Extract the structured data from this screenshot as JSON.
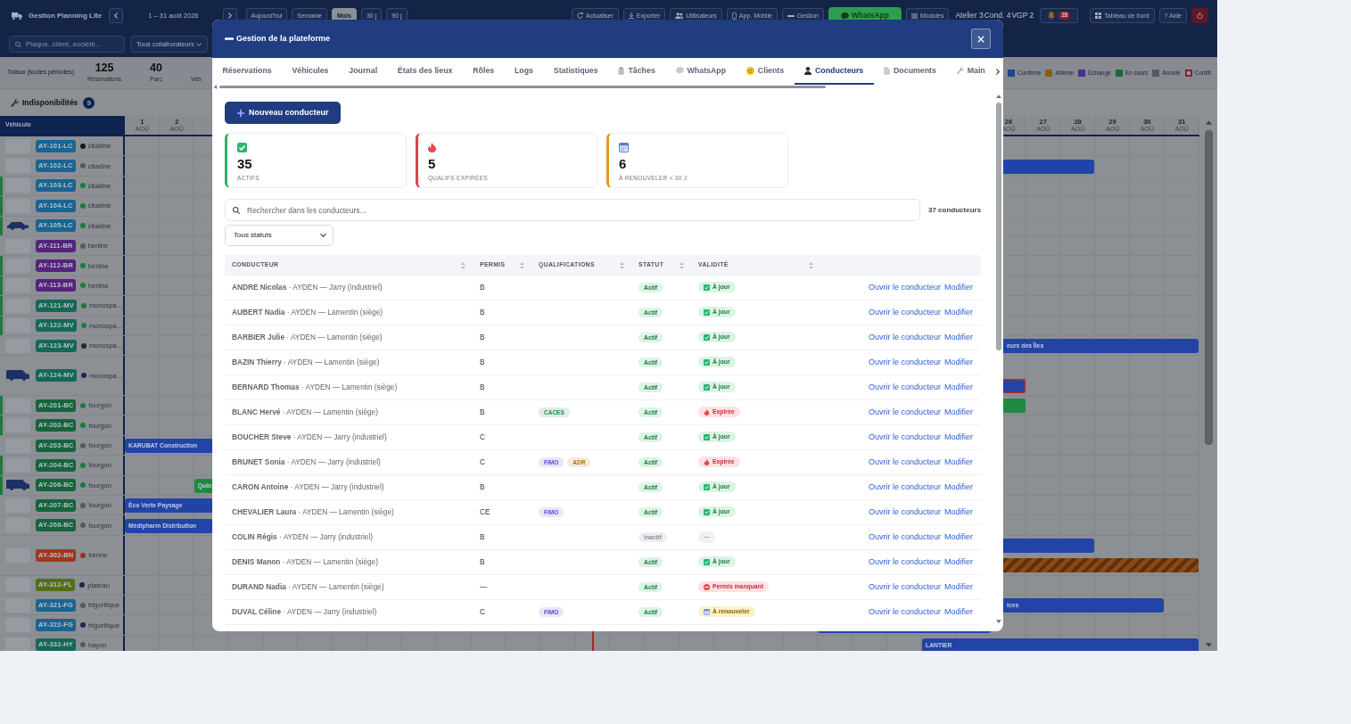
{
  "navbar": {
    "title": "Gestion Planning Lite",
    "period": "1 – 31 août 2026",
    "views": [
      {
        "label": "Aujourd'hui",
        "selected": false
      },
      {
        "label": "Semaine",
        "selected": false
      },
      {
        "label": "Mois",
        "selected": true
      },
      {
        "label": "30 j",
        "selected": false
      },
      {
        "label": "90 j",
        "selected": false
      }
    ],
    "actions": [
      {
        "label": "Actualiser",
        "highlighted": false
      },
      {
        "label": "Exporter",
        "highlighted": false
      },
      {
        "label": "Utilisateurs",
        "highlighted": false
      },
      {
        "label": "App. Mobile",
        "highlighted": false
      },
      {
        "label": "Gestion",
        "highlighted": false
      },
      {
        "label": "WhatsApp",
        "highlighted": true
      },
      {
        "label": "Modules",
        "highlighted": false
      }
    ],
    "counters": [
      "Atelier 3",
      "Cond. 4",
      "VGP 2"
    ],
    "notifications": "28",
    "dashboard": "Tableau de bord",
    "help": "? Aide",
    "search": {
      "placeholder": "Plaque, client, société..."
    },
    "collaborator_filter": "Tous collaborateurs"
  },
  "totals": {
    "label": "Totaux (toutes périodes)",
    "items": [
      {
        "value": "125",
        "label": "Réservations"
      },
      {
        "value": "40",
        "label": "Parc"
      },
      {
        "label": "Véh"
      }
    ]
  },
  "legend": [
    {
      "label": "Confirmé",
      "color": "#22428b",
      "kind": "fill"
    },
    {
      "label": "Attente",
      "color": "#8a5e0f",
      "kind": "fill"
    },
    {
      "label": "Échange",
      "color": "#48308a",
      "kind": "fill"
    },
    {
      "label": "En cours",
      "color": "#1a6a36",
      "kind": "fill"
    },
    {
      "label": "Annulé",
      "color": "#55585e",
      "kind": "fill"
    },
    {
      "label": "Conflit",
      "color": "#8c1f26",
      "kind": "outline"
    }
  ],
  "unavailability": {
    "label": "Indisponibilités",
    "count": "9"
  },
  "planning": {
    "vehicle_header": "Véhicule",
    "days": [
      {
        "day": "1",
        "month": "AOÛ"
      },
      {
        "day": "2",
        "month": "AOÛ"
      },
      {
        "day": "26",
        "month": "AOÛ"
      },
      {
        "day": "27",
        "month": "AOÛ"
      },
      {
        "day": "28",
        "month": "AOÛ"
      },
      {
        "day": "29",
        "month": "AOÛ"
      },
      {
        "day": "30",
        "month": "AOÛ"
      },
      {
        "day": "31",
        "month": "AOÛ"
      }
    ],
    "vehicles": [
      {
        "plate": "AY-101-LC",
        "color": "#196491",
        "type": "citadine",
        "status": {
          "color": "#15181e"
        },
        "kind": "blank",
        "highlighted": false
      },
      {
        "plate": "AY-102-LC",
        "color": "#196491",
        "type": "citadine",
        "status": {
          "color": "#55595f"
        },
        "kind": "blank",
        "highlighted": false,
        "bookings": [
          {
            "kind": "confirmed"
          }
        ]
      },
      {
        "plate": "AY-103-LC",
        "color": "#196491",
        "type": "citadine",
        "status": {
          "color": "#1c7a3c"
        },
        "kind": "blank",
        "highlighted": true
      },
      {
        "plate": "AY-104-LC",
        "color": "#196491",
        "type": "citadine",
        "status": {
          "color": "#1c7a3c"
        },
        "kind": "blank",
        "highlighted": true
      },
      {
        "plate": "AY-105-LC",
        "color": "#196491",
        "type": "citadine",
        "status": {
          "color": "#1c7a3c"
        },
        "kind": "car",
        "highlighted": true
      },
      {
        "plate": "AY-111-BR",
        "color": "#55237d",
        "type": "berline",
        "status": {
          "color": "#55595f"
        },
        "kind": "blank",
        "highlighted": false
      },
      {
        "plate": "AY-112-BR",
        "color": "#55237d",
        "type": "berline",
        "status": {
          "color": "#1c7a3c"
        },
        "kind": "blank",
        "highlighted": true
      },
      {
        "plate": "AY-113-BR",
        "color": "#55237d",
        "type": "berline",
        "status": {
          "color": "#1c7a3c"
        },
        "kind": "blank",
        "highlighted": true
      },
      {
        "plate": "AY-121-MV",
        "color": "#146955",
        "type": "monospa…",
        "status": {
          "color": "#1c7a3c"
        },
        "kind": "blank",
        "highlighted": true
      },
      {
        "plate": "AY-122-MV",
        "color": "#146955",
        "type": "monospa…",
        "status": {
          "color": "#1c7a3c"
        },
        "kind": "blank",
        "highlighted": true
      },
      {
        "plate": "AY-123-MV",
        "color": "#146955",
        "type": "monospa…",
        "status": {
          "color": "#23272f"
        },
        "kind": "blank",
        "highlighted": false,
        "bookings": [
          {
            "label": "eurs des Îles",
            "kind": "confirmed"
          }
        ]
      },
      {
        "plate": "AY-124-MV",
        "color": "#146955",
        "type": "monospa…",
        "status": {
          "color": "#1c2a4a"
        },
        "kind": "van",
        "highlighted": false,
        "second_lane": [
          {
            "kind": "conflict"
          }
        ]
      },
      {
        "plate": "AY-201-BC",
        "color": "#16643c",
        "type": "fourgon",
        "status": {
          "color": "#1c7a3c"
        },
        "kind": "blank",
        "highlighted": true,
        "bookings": [
          {
            "kind": "in_progress"
          }
        ]
      },
      {
        "plate": "AY-202-BC",
        "color": "#16643c",
        "type": "fourgon",
        "status": {
          "color": "#1c7a3c"
        },
        "kind": "blank",
        "highlighted": true
      },
      {
        "plate": "AY-203-BC",
        "color": "#16643c",
        "type": "fourgon",
        "status": {
          "color": "#55595f"
        },
        "kind": "blank",
        "highlighted": false,
        "bookings": [
          {
            "label": "KARUBAT Construction",
            "kind": "confirmed"
          }
        ]
      },
      {
        "plate": "AY-204-BC",
        "color": "#16643c",
        "type": "fourgon",
        "status": {
          "color": "#1c7a3c"
        },
        "kind": "blank",
        "highlighted": true
      },
      {
        "plate": "AY-206-BC",
        "color": "#16643c",
        "type": "fourgon",
        "status": {
          "color": "#1c7a3c"
        },
        "kind": "van",
        "highlighted": true,
        "bookings": [
          {
            "label": "Quin",
            "kind": "in_progress"
          }
        ]
      },
      {
        "plate": "AY-207-BC",
        "color": "#16643c",
        "type": "fourgon",
        "status": {
          "color": "#55595f"
        },
        "kind": "blank",
        "highlighted": false,
        "bookings": [
          {
            "label": "Éco Verte Paysage",
            "kind": "confirmed"
          }
        ]
      },
      {
        "plate": "AY-208-BC",
        "color": "#16643c",
        "type": "fourgon",
        "status": {
          "color": "#55595f"
        },
        "kind": "blank",
        "highlighted": false,
        "bookings": [
          {
            "label": "Médipharm Distribution",
            "kind": "confirmed"
          }
        ]
      },
      {
        "plate": "AY-302-BN",
        "color": "#a0371e",
        "type": "benne",
        "status": {
          "color": "#a3262e"
        },
        "kind": "blank",
        "highlighted": false,
        "bookings": [
          {
            "kind": "confirmed"
          }
        ],
        "second_lane": [
          {
            "kind": "unavailable"
          }
        ]
      },
      {
        "plate": "AY-312-PL",
        "color": "#556e14",
        "type": "plateau",
        "status": {
          "color": "#1c2a4a"
        },
        "kind": "blank",
        "highlighted": false
      },
      {
        "plate": "AY-321-FG",
        "color": "#196491",
        "type": "frigorifique",
        "status": {
          "color": "#55595f"
        },
        "kind": "blank",
        "highlighted": false,
        "bookings": [
          {
            "label": "ices",
            "kind": "confirmed"
          }
        ]
      },
      {
        "plate": "AY-322-FG",
        "color": "#196491",
        "type": "frigorifique",
        "status": {
          "color": "#1c2a4a"
        },
        "kind": "blank",
        "highlighted": false,
        "bookings": [
          {
            "kind": "confirmed"
          }
        ]
      },
      {
        "plate": "AY-332-HY",
        "color": "#146955",
        "type": "hayon",
        "status": {
          "color": "#55595f"
        },
        "kind": "blank",
        "highlighted": false,
        "bookings": [
          {
            "label": "LANTIER",
            "kind": "confirmed"
          }
        ]
      }
    ]
  },
  "dialog": {
    "title": "Gestion de la plateforme",
    "tabs": [
      {
        "label": "Réservations",
        "selected": false
      },
      {
        "label": "Véhicules",
        "selected": false
      },
      {
        "label": "Journal",
        "selected": false
      },
      {
        "label": "États des lieux",
        "selected": false
      },
      {
        "label": "Rôles",
        "selected": false
      },
      {
        "label": "Logs",
        "selected": false
      },
      {
        "label": "Statistiques",
        "selected": false
      },
      {
        "label": "Tâches",
        "selected": false
      },
      {
        "label": "WhatsApp",
        "selected": false
      },
      {
        "label": "Clients",
        "selected": false
      },
      {
        "label": "Conducteurs",
        "selected": true
      },
      {
        "label": "Documents",
        "selected": false
      },
      {
        "label": "Main",
        "selected": false
      }
    ],
    "new_button": "Nouveau conducteur",
    "stats": [
      {
        "value": "35",
        "label": "ACTIFS",
        "color": "#2fb36b"
      },
      {
        "value": "5",
        "label": "QUALIFS EXPIRÉES",
        "color": "#d9434e"
      },
      {
        "value": "6",
        "label": "À RENOUVELER < 30 J",
        "color": "#e39b1b"
      }
    ],
    "search": {
      "placeholder": "Rechercher dans les conducteurs..."
    },
    "count": "37 conducteurs",
    "status_filter": "Tous statuts",
    "table": {
      "columns": [
        "CONDUCTEUR",
        "PERMIS",
        "QUALIFICATIONS",
        "STATUT",
        "VALIDITÉ"
      ],
      "rows": [
        {
          "driver": "**ANDRE Nicolas** · AYDEN — Jarry (industriel)",
          "license": "B",
          "status": {
            "label": "Actif",
            "kind": "active"
          },
          "validity": {
            "label": "À jour",
            "kind": "ok"
          },
          "actions": [
            "Ouvrir le conducteur",
            "Modifier"
          ]
        },
        {
          "driver": "**AUBERT Nadia** · AYDEN — Lamentin (siège)",
          "license": "B",
          "status": {
            "label": "Actif",
            "kind": "active"
          },
          "validity": {
            "label": "À jour",
            "kind": "ok"
          },
          "actions": [
            "Ouvrir le conducteur",
            "Modifier"
          ]
        },
        {
          "driver": "**BARBIER Julie** · AYDEN — Lamentin (siège)",
          "license": "B",
          "status": {
            "label": "Actif",
            "kind": "active"
          },
          "validity": {
            "label": "À jour",
            "kind": "ok"
          },
          "actions": [
            "Ouvrir le conducteur",
            "Modifier"
          ]
        },
        {
          "driver": "**BAZIN Thierry** · AYDEN — Lamentin (siège)",
          "license": "B",
          "status": {
            "label": "Actif",
            "kind": "active"
          },
          "validity": {
            "label": "À jour",
            "kind": "ok"
          },
          "actions": [
            "Ouvrir le conducteur",
            "Modifier"
          ]
        },
        {
          "driver": "**BERNARD Thomas** · AYDEN — Lamentin (siège)",
          "license": "B",
          "status": {
            "label": "Actif",
            "kind": "active"
          },
          "validity": {
            "label": "À jour",
            "kind": "ok"
          },
          "actions": [
            "Ouvrir le conducteur",
            "Modifier"
          ]
        },
        {
          "driver": "**BLANC Hervé** · AYDEN — Lamentin (siège)",
          "license": "B",
          "qualifications": [
            {
              "label": "CACES",
              "color": "#1e8a4c"
            }
          ],
          "status": {
            "label": "Actif",
            "kind": "active"
          },
          "validity": {
            "label": "Expirée",
            "kind": "expired"
          },
          "actions": [
            "Ouvrir le conducteur",
            "Modifier"
          ]
        },
        {
          "driver": "**BOUCHER Steve** · AYDEN — Jarry (industriel)",
          "license": "C",
          "status": {
            "label": "Actif",
            "kind": "active"
          },
          "validity": {
            "label": "À jour",
            "kind": "ok"
          },
          "actions": [
            "Ouvrir le conducteur",
            "Modifier"
          ]
        },
        {
          "driver": "**BRUNET Sonia** · AYDEN — Jarry (industriel)",
          "license": "C",
          "qualifications": [
            {
              "label": "FIMO",
              "color": "#5a4fcf"
            },
            {
              "label": "ADR",
              "color": "#b06d00"
            }
          ],
          "status": {
            "label": "Actif",
            "kind": "active"
          },
          "validity": {
            "label": "Expirée",
            "kind": "expired"
          },
          "actions": [
            "Ouvrir le conducteur",
            "Modifier"
          ]
        },
        {
          "driver": "**CARON Antoine** · AYDEN — Jarry (industriel)",
          "license": "B",
          "status": {
            "label": "Actif",
            "kind": "active"
          },
          "validity": {
            "label": "À jour",
            "kind": "ok"
          },
          "actions": [
            "Ouvrir le conducteur",
            "Modifier"
          ]
        },
        {
          "driver": "**CHEVALIER Laura** · AYDEN — Lamentin (siège)",
          "license": "CE",
          "qualifications": [
            {
              "label": "FIMO",
              "color": "#5a4fcf"
            }
          ],
          "status": {
            "label": "Actif",
            "kind": "active"
          },
          "validity": {
            "label": "À jour",
            "kind": "ok"
          },
          "actions": [
            "Ouvrir le conducteur",
            "Modifier"
          ]
        },
        {
          "driver": "**COLIN Régis** · AYDEN — Jarry (industriel)",
          "license": "B",
          "status": {
            "label": "Inactif",
            "kind": "inactive"
          },
          "validity": {
            "label": "—",
            "kind": "none"
          },
          "actions": [
            "Ouvrir le conducteur",
            "Modifier"
          ]
        },
        {
          "driver": "**DENIS Manon** · AYDEN — Lamentin (siège)",
          "license": "B",
          "status": {
            "label": "Actif",
            "kind": "active"
          },
          "validity": {
            "label": "À jour",
            "kind": "ok"
          },
          "actions": [
            "Ouvrir le conducteur",
            "Modifier"
          ]
        },
        {
          "driver": "**DURAND Nadia** · AYDEN — Lamentin (siège)",
          "license": "—",
          "status": {
            "label": "Actif",
            "kind": "active"
          },
          "validity": {
            "label": "Permis manquant",
            "kind": "missing"
          },
          "actions": [
            "Ouvrir le conducteur",
            "Modifier"
          ]
        },
        {
          "driver": "**DUVAL Céline** · AYDEN — Jarry (industriel)",
          "license": "C",
          "qualifications": [
            {
              "label": "FIMO",
              "color": "#5a4fcf"
            }
          ],
          "status": {
            "label": "Actif",
            "kind": "active"
          },
          "validity": {
            "label": "À renouveler",
            "kind": "renew"
          },
          "actions": [
            "Ouvrir le conducteur",
            "Modifier"
          ]
        }
      ]
    }
  }
}
